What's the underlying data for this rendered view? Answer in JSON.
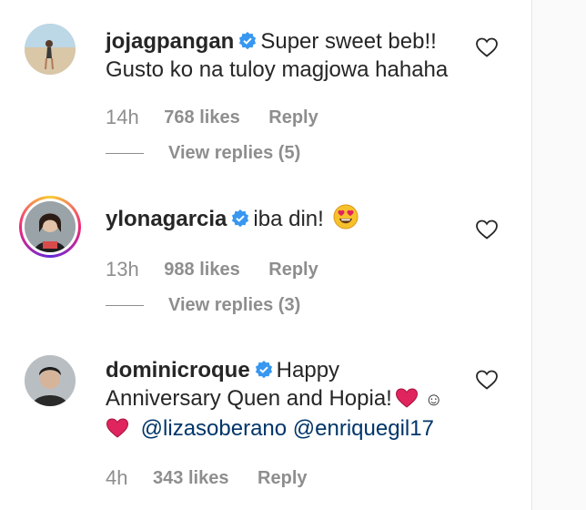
{
  "comments": [
    {
      "username": "jojagpangan",
      "text_line1": "Super sweet beb!!",
      "text_line2": "Gusto ko na tuloy magjowa hahaha",
      "time": "14h",
      "likes": "768 likes",
      "reply": "Reply",
      "view_replies": "View replies (5)",
      "avatar_icon": "beach-photo-avatar"
    },
    {
      "username": "ylonagarcia",
      "text": "iba din!",
      "emoji_icon": "heart-eyes-emoji",
      "time": "13h",
      "likes": "988 likes",
      "reply": "Reply",
      "view_replies": "View replies (3)",
      "avatar_icon": "portrait-avatar-story-ring"
    },
    {
      "username": "dominicroque",
      "text_line1": "Happy",
      "text_line2": "Anniversary Quen and Hopia!",
      "smiley": "☺",
      "mention1": "@lizasoberano",
      "mention2": "@enriquegil17",
      "time": "4h",
      "likes": "343 likes",
      "reply": "Reply",
      "avatar_icon": "portrait-avatar"
    }
  ],
  "colors": {
    "verified": "#3897f0",
    "heart": "#e0245e",
    "muted": "#8e8e8e",
    "mention": "#003569"
  }
}
